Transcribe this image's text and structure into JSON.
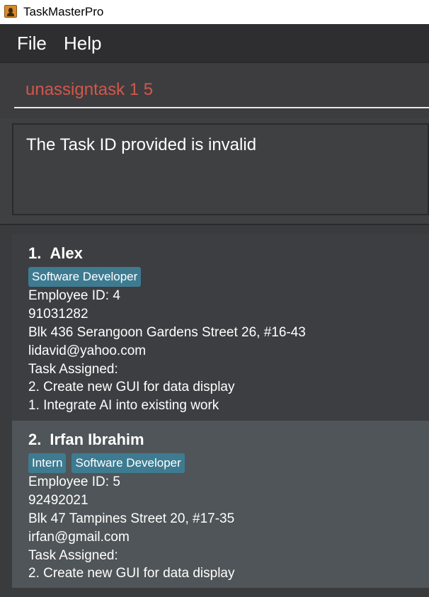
{
  "window": {
    "title": "TaskMasterPro",
    "icon": "app-user-icon"
  },
  "menu": {
    "file": "File",
    "help": "Help"
  },
  "command": {
    "text": "unassigntask 1 5"
  },
  "result": {
    "message": "The Task ID provided is invalid"
  },
  "persons": [
    {
      "index": "1.",
      "name": "Alex",
      "tags": [
        "Software Developer"
      ],
      "employee_id": "Employee ID: 4",
      "phone": "91031282",
      "address": "Blk 436 Serangoon Gardens Street 26, #16-43",
      "email": "lidavid@yahoo.com",
      "task_header": "Task Assigned:",
      "tasks": [
        "2. Create new GUI for data display",
        "1. Integrate AI into existing work"
      ]
    },
    {
      "index": "2.",
      "name": "Irfan Ibrahim",
      "tags": [
        "Intern",
        "Software Developer"
      ],
      "employee_id": "Employee ID: 5",
      "phone": "92492021",
      "address": "Blk 47 Tampines Street 20, #17-35",
      "email": "irfan@gmail.com",
      "task_header": "Task Assigned:",
      "tasks": [
        "2. Create new GUI for data display"
      ]
    }
  ]
}
